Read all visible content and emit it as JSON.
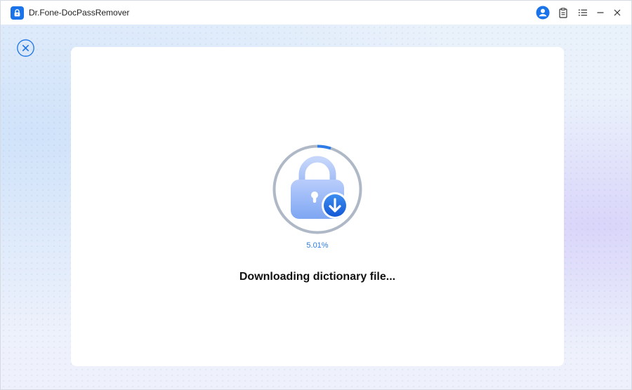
{
  "window": {
    "title": "Dr.Fone-DocPassRemover"
  },
  "titlebar": {
    "icons": [
      "lock-app-icon",
      "user-account-icon",
      "feedback-document-icon",
      "menu-list-icon",
      "minimize-icon",
      "close-icon"
    ]
  },
  "download": {
    "percent_text": "5.01%",
    "progress_fraction": 0.0501,
    "status_text": "Downloading dictionary file..."
  },
  "colors": {
    "accent": "#1a73e8",
    "progress": "#2d7be5",
    "ring_track": "#aeb8c6",
    "background": "#e9f1fb"
  }
}
